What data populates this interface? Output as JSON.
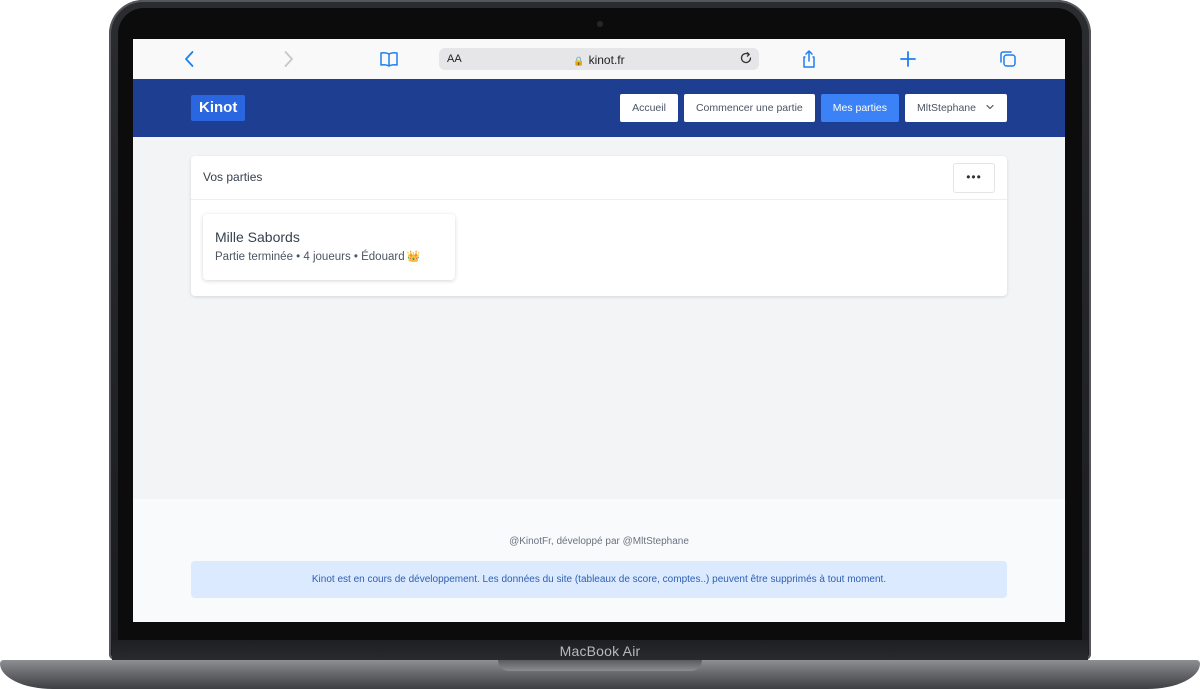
{
  "browser": {
    "text_size_label": "AA",
    "url": "kinot.fr",
    "icons": [
      "back-icon",
      "forward-icon",
      "bookmarks-icon",
      "lock-icon",
      "reload-icon",
      "share-icon",
      "new-tab-icon",
      "tabs-icon"
    ]
  },
  "header": {
    "brand": "Kinot",
    "nav": {
      "home": "Accueil",
      "start_game": "Commencer une partie",
      "my_games": "Mes parties",
      "user": "MltStephane"
    },
    "colors": {
      "header_bg": "#1e3f91",
      "brand_bg": "#2a66e0",
      "active": "#3b82f6"
    }
  },
  "main": {
    "card_title": "Vos parties",
    "more_label": "•••",
    "games": [
      {
        "name": "Mille Sabords",
        "meta": "Partie terminée • 4 joueurs • Édouard",
        "winner_icon": "crown-icon"
      }
    ]
  },
  "footer": {
    "credit": "@KinotFr, développé par @MltStephane",
    "notice": "Kinot est en cours de développement. Les données du site (tableaux de score, comptes..) peuvent être supprimés à tout moment."
  },
  "device": {
    "label": "MacBook Air"
  }
}
